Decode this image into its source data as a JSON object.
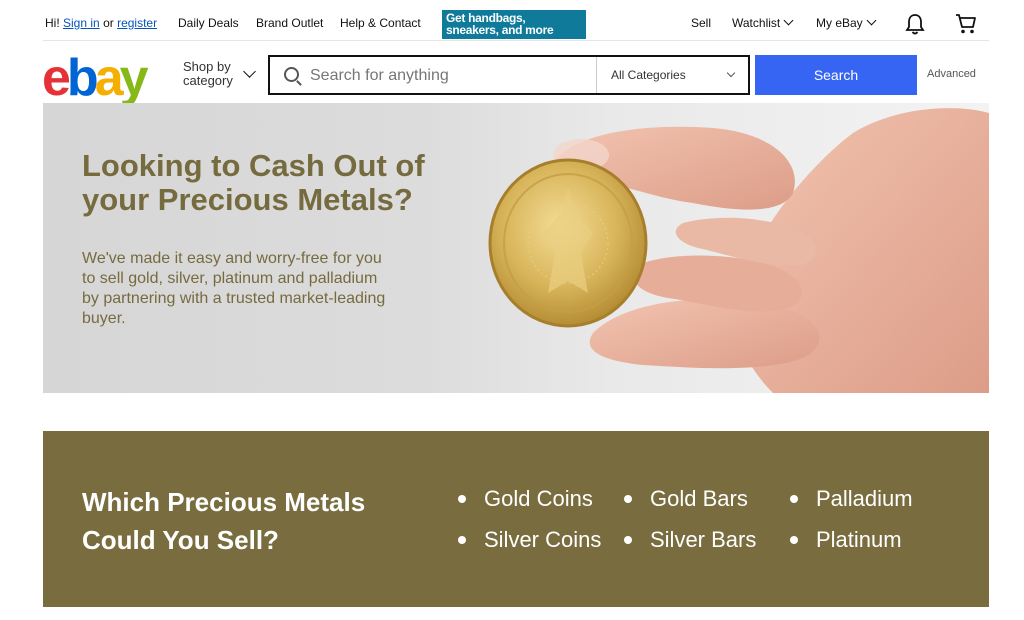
{
  "topbar": {
    "greeting": "Hi!",
    "sign_in": "Sign in",
    "or": "or",
    "register": "register",
    "daily_deals": "Daily Deals",
    "brand_outlet": "Brand Outlet",
    "help_contact": "Help & Contact",
    "promo_line1": "Get handbags,",
    "promo_line2": "sneakers, and more",
    "sell": "Sell",
    "watchlist": "Watchlist",
    "my_ebay": "My eBay",
    "icons": [
      "bell-icon",
      "cart-icon",
      "chevron-down-icon"
    ]
  },
  "header": {
    "logo": {
      "e": "e",
      "b": "b",
      "a": "a",
      "y": "y"
    },
    "shop_by_line1": "Shop by",
    "shop_by_line2": "category",
    "search_placeholder": "Search for anything",
    "category_select": "All Categories",
    "search_button": "Search",
    "advanced": "Advanced"
  },
  "hero": {
    "title": "Looking to Cash Out of your Precious Metals?",
    "body": "We've made it easy and worry-free for you to sell gold, silver, platinum and palladium by partnering with a trusted market-leading buyer."
  },
  "band": {
    "title": "Which Precious Metals Could You Sell?",
    "metals": [
      "Gold Coins",
      "Gold Bars",
      "Palladium",
      "Silver Coins",
      "Silver Bars",
      "Platinum"
    ]
  },
  "colors": {
    "accent_blue": "#3665f3",
    "link_blue": "#0654ba",
    "olive": "#796c3e",
    "olive_text": "#766b3f",
    "promo_teal": "#0f7a9a"
  }
}
